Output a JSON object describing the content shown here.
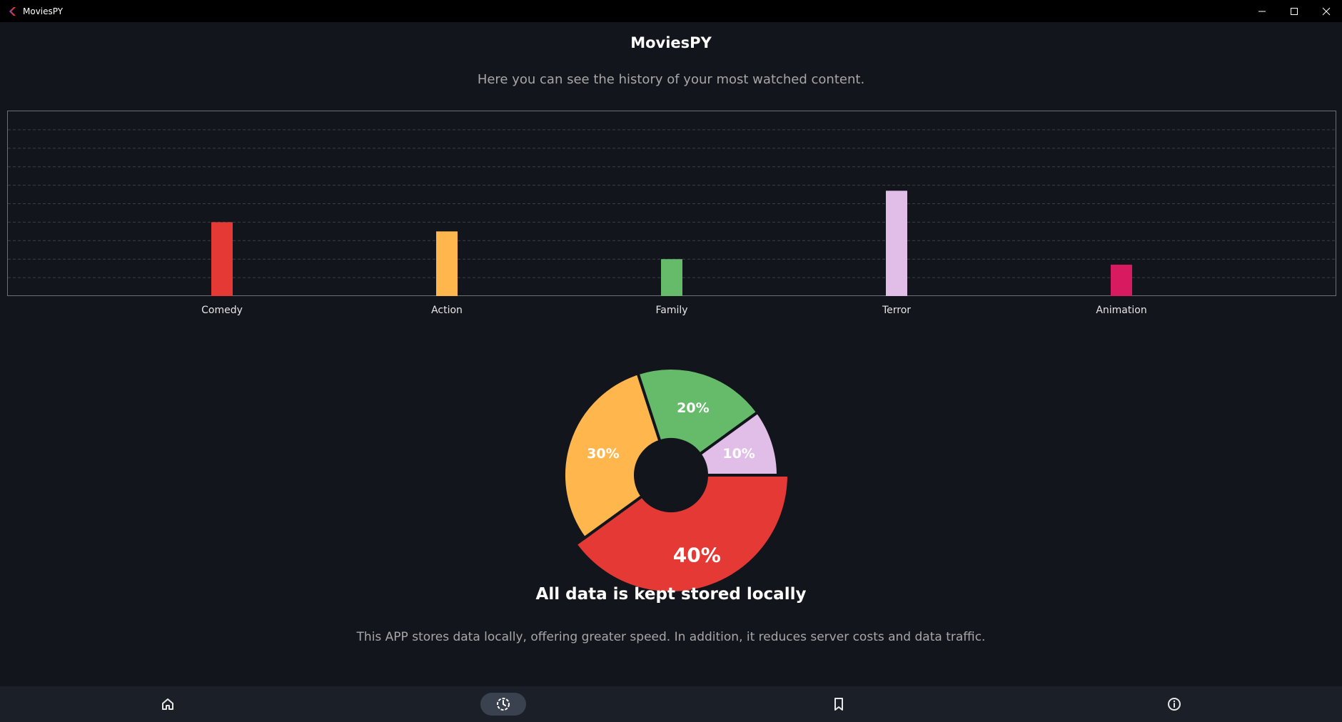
{
  "window": {
    "title": "MoviesPY"
  },
  "page": {
    "title": "MoviesPY",
    "subtitle": "Here you can see the history of your most watched content."
  },
  "footer": {
    "title": "All data is kept stored locally",
    "text": "This APP stores data locally, offering greater speed. In addition, it reduces server costs and data traffic."
  },
  "nav": {
    "items": [
      {
        "icon": "home-icon",
        "active": false
      },
      {
        "icon": "history-icon",
        "active": true
      },
      {
        "icon": "bookmark-icon",
        "active": false
      },
      {
        "icon": "info-icon",
        "active": false
      }
    ]
  },
  "colors": {
    "comedy": "#e53935",
    "action": "#ffb74d",
    "family": "#66bb6a",
    "terror": "#e1bee7",
    "animation": "#d81b60"
  },
  "chart_data": [
    {
      "type": "bar",
      "categories": [
        "Comedy",
        "Action",
        "Family",
        "Terror",
        "Animation"
      ],
      "values": [
        4,
        3.5,
        2,
        5.7,
        1.7
      ],
      "colors": [
        "#e53935",
        "#ffb74d",
        "#66bb6a",
        "#e1bee7",
        "#d81b60"
      ],
      "ylim": [
        0,
        10
      ],
      "grid": true
    },
    {
      "type": "pie",
      "slices": [
        {
          "label": "40%",
          "value": 40,
          "color": "#e53935"
        },
        {
          "label": "30%",
          "value": 30,
          "color": "#ffb74d"
        },
        {
          "label": "20%",
          "value": 20,
          "color": "#66bb6a"
        },
        {
          "label": "10%",
          "value": 10,
          "color": "#e1bee7"
        }
      ],
      "donut": true,
      "highlighted": "40%"
    }
  ]
}
